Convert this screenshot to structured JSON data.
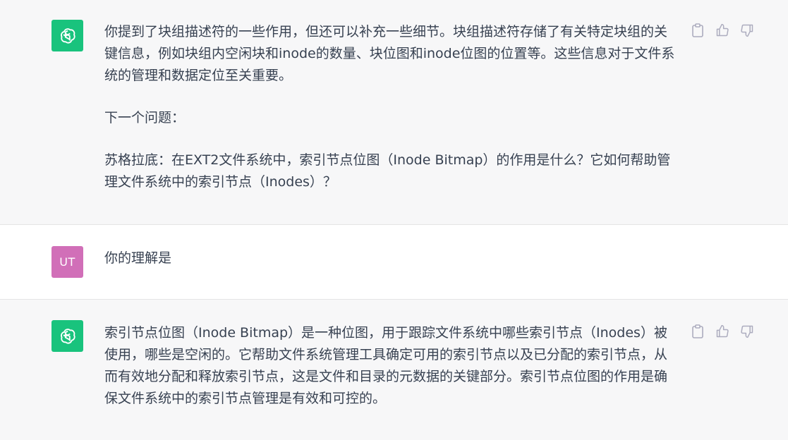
{
  "conversation": {
    "messages": [
      {
        "role": "assistant",
        "paragraphs": [
          "你提到了块组描述符的一些作用，但还可以补充一些细节。块组描述符存储了有关特定块组的关键信息，例如块组内空闲块和inode的数量、块位图和inode位图的位置等。这些信息对于文件系统的管理和数据定位至关重要。",
          "下一个问题：",
          "苏格拉底：在EXT2文件系统中，索引节点位图（Inode Bitmap）的作用是什么？它如何帮助管理文件系统中的索引节点（Inodes）？"
        ]
      },
      {
        "role": "user",
        "avatar_initials": "UT",
        "paragraphs": [
          "你的理解是"
        ]
      },
      {
        "role": "assistant",
        "paragraphs": [
          "索引节点位图（Inode Bitmap）是一种位图，用于跟踪文件系统中哪些索引节点（Inodes）被使用，哪些是空闲的。它帮助文件系统管理工具确定可用的索引节点以及已分配的索引节点，从而有效地分配和释放索引节点，这是文件和目录的元数据的关键部分。索引节点位图的作用是确保文件系统中的索引节点管理是有效和可控的。"
        ]
      }
    ]
  },
  "icons": {
    "assistant_avatar": "openai-logo-icon",
    "copy": "clipboard-icon",
    "like": "thumbs-up-icon",
    "dislike": "thumbs-down-icon"
  },
  "colors": {
    "assistant_bg": "#f7f7f8",
    "assistant_avatar_bg": "#19c37d",
    "user_avatar_bg": "#d16fb8",
    "text": "#374151",
    "icon": "#acacbe"
  }
}
